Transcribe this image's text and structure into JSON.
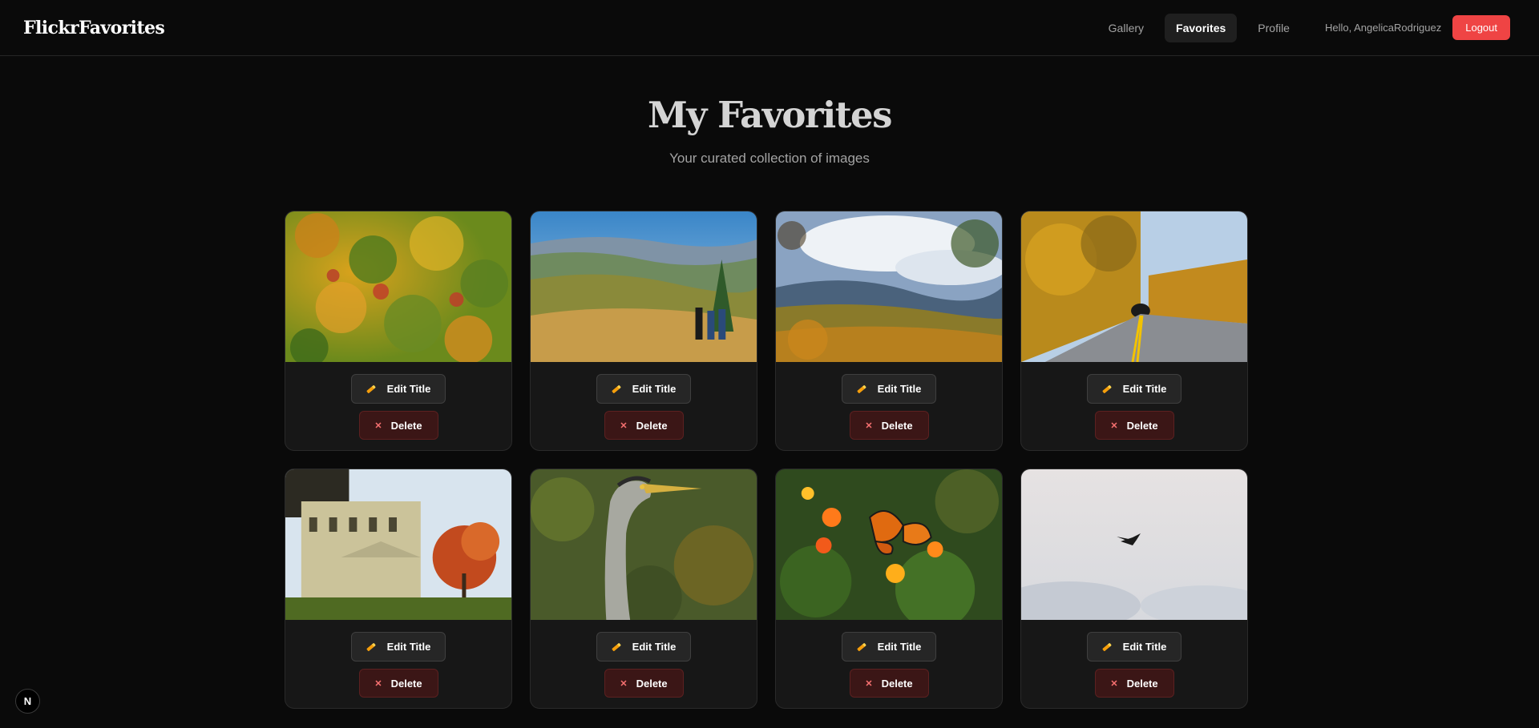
{
  "header": {
    "brand": "FlickrFavorites",
    "nav": [
      {
        "label": "Gallery",
        "active": false
      },
      {
        "label": "Favorites",
        "active": true
      },
      {
        "label": "Profile",
        "active": false
      }
    ],
    "greeting": "Hello, AngelicaRodriguez",
    "logout_label": "Logout",
    "accent_color": "#ef4444"
  },
  "hero": {
    "title": "My Favorites",
    "subtitle": "Your curated collection of images"
  },
  "cards": [
    {
      "scene": "autumn-forest-canopy",
      "edit_label": "Edit Title",
      "delete_label": "Delete"
    },
    {
      "scene": "mountain-overlook-hikers",
      "edit_label": "Edit Title",
      "delete_label": "Delete"
    },
    {
      "scene": "misty-mountain-autumn",
      "edit_label": "Edit Title",
      "delete_label": "Delete"
    },
    {
      "scene": "road-tunnel-autumn",
      "edit_label": "Edit Title",
      "delete_label": "Delete"
    },
    {
      "scene": "historic-building-red-tree",
      "edit_label": "Edit Title",
      "delete_label": "Delete"
    },
    {
      "scene": "heron-portrait",
      "edit_label": "Edit Title",
      "delete_label": "Delete"
    },
    {
      "scene": "monarch-butterfly-flowers",
      "edit_label": "Edit Title",
      "delete_label": "Delete"
    },
    {
      "scene": "bird-in-cloudy-sky",
      "edit_label": "Edit Title",
      "delete_label": "Delete"
    }
  ],
  "icons": {
    "edit": "pencil-icon",
    "delete": "close-icon",
    "dev_badge": "N"
  }
}
